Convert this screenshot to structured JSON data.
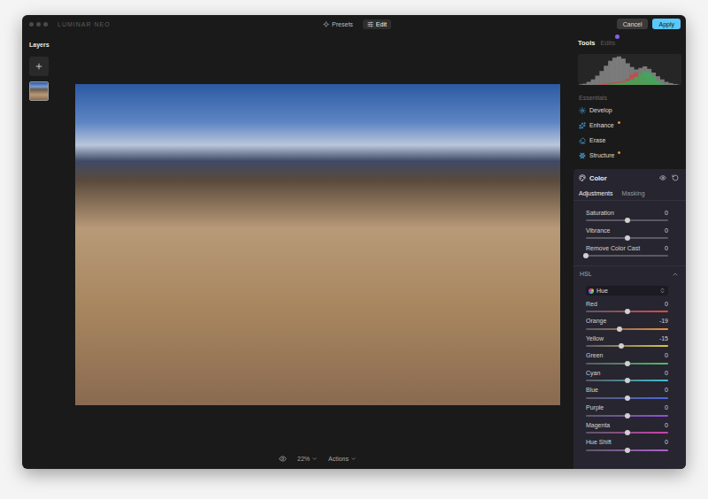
{
  "window": {
    "title": "LUMINAR NEO"
  },
  "modes": [
    {
      "label": "Presets",
      "selected": false
    },
    {
      "label": "Edit",
      "selected": true
    }
  ],
  "actions": [
    {
      "label": "Cancel",
      "primary": false
    },
    {
      "label": "Apply",
      "primary": true
    }
  ],
  "layers": {
    "title": "Layers"
  },
  "canvas": {
    "zoom": "22%",
    "actions": "Actions"
  },
  "panel_tabs": [
    {
      "label": "Tools",
      "selected": true,
      "badge": false
    },
    {
      "label": "Edits",
      "selected": false,
      "badge": true
    }
  ],
  "histogram": {
    "series": [
      {
        "name": "luminance",
        "color": "#8a8a8a",
        "values": [
          2,
          4,
          10,
          18,
          30,
          45,
          62,
          78,
          88,
          92,
          85,
          70,
          58,
          50,
          55,
          60,
          52,
          40,
          28,
          18,
          10,
          6,
          3,
          1
        ]
      },
      {
        "name": "red",
        "color": "#c84848",
        "values": [
          0,
          0,
          0,
          0,
          0,
          2,
          4,
          6,
          8,
          10,
          12,
          20,
          34,
          40,
          36,
          24,
          12,
          6,
          2,
          0,
          0,
          0,
          0,
          0
        ]
      },
      {
        "name": "green",
        "color": "#3ea85a",
        "values": [
          0,
          0,
          0,
          0,
          0,
          0,
          0,
          2,
          4,
          6,
          8,
          12,
          18,
          26,
          38,
          44,
          40,
          28,
          14,
          4,
          0,
          0,
          0,
          0
        ]
      }
    ]
  },
  "essentials": {
    "title": "Essentials",
    "tools": [
      {
        "label": "Develop",
        "ai": false
      },
      {
        "label": "Enhance",
        "ai": true
      },
      {
        "label": "Erase",
        "ai": false
      },
      {
        "label": "Structure",
        "ai": true
      }
    ]
  },
  "color": {
    "title": "Color",
    "expanded": true,
    "tabs": [
      {
        "label": "Adjustments",
        "selected": true
      },
      {
        "label": "Masking",
        "selected": false
      }
    ],
    "sliders": [
      {
        "label": "Saturation",
        "value": "0",
        "level": 0.5
      },
      {
        "label": "Vibrance",
        "value": "0",
        "level": 0.5
      },
      {
        "label": "Remove Color Cast",
        "value": "0",
        "level": 0
      }
    ],
    "hsl": {
      "title": "HSL",
      "expanded": true,
      "mode": "Hue",
      "sliders": [
        {
          "label": "Red",
          "value": "0",
          "level": 0.5,
          "color": "#e04848"
        },
        {
          "label": "Orange",
          "value": "-19",
          "level": 0.405,
          "color": "#e8903a"
        },
        {
          "label": "Yellow",
          "value": "-15",
          "level": 0.425,
          "color": "#d8c840"
        },
        {
          "label": "Green",
          "value": "0",
          "level": 0.5,
          "color": "#4cc060"
        },
        {
          "label": "Cyan",
          "value": "0",
          "level": 0.5,
          "color": "#40c0d0"
        },
        {
          "label": "Blue",
          "value": "0",
          "level": 0.5,
          "color": "#4a68e0"
        },
        {
          "label": "Purple",
          "value": "0",
          "level": 0.5,
          "color": "#9050e0"
        },
        {
          "label": "Magenta",
          "value": "0",
          "level": 0.5,
          "color": "#d040b0"
        },
        {
          "label": "Hue Shift",
          "value": "0",
          "level": 0.5,
          "color": "#b060d0"
        }
      ]
    }
  }
}
